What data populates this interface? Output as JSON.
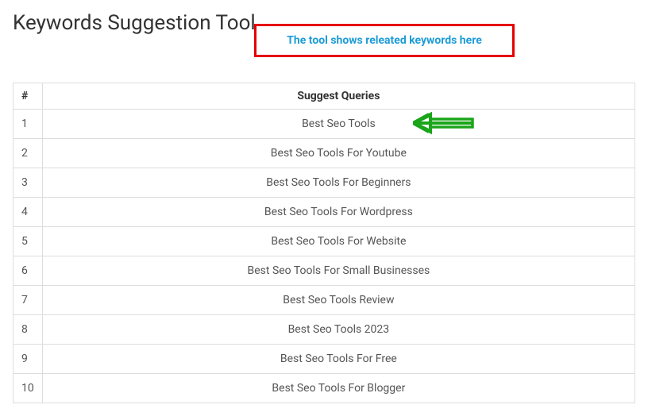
{
  "page": {
    "title": "Keywords Suggestion Tool"
  },
  "callout": {
    "text": "The tool shows releated keywords here"
  },
  "table": {
    "headers": {
      "num": "#",
      "query": "Suggest Queries"
    },
    "rows": [
      {
        "num": "1",
        "query": "Best Seo Tools"
      },
      {
        "num": "2",
        "query": "Best Seo Tools For Youtube"
      },
      {
        "num": "3",
        "query": "Best Seo Tools For Beginners"
      },
      {
        "num": "4",
        "query": "Best Seo Tools For Wordpress"
      },
      {
        "num": "5",
        "query": "Best Seo Tools For Website"
      },
      {
        "num": "6",
        "query": "Best Seo Tools For Small Businesses"
      },
      {
        "num": "7",
        "query": "Best Seo Tools Review"
      },
      {
        "num": "8",
        "query": "Best Seo Tools 2023"
      },
      {
        "num": "9",
        "query": "Best Seo Tools For Free"
      },
      {
        "num": "10",
        "query": "Best Seo Tools For Blogger"
      }
    ]
  }
}
